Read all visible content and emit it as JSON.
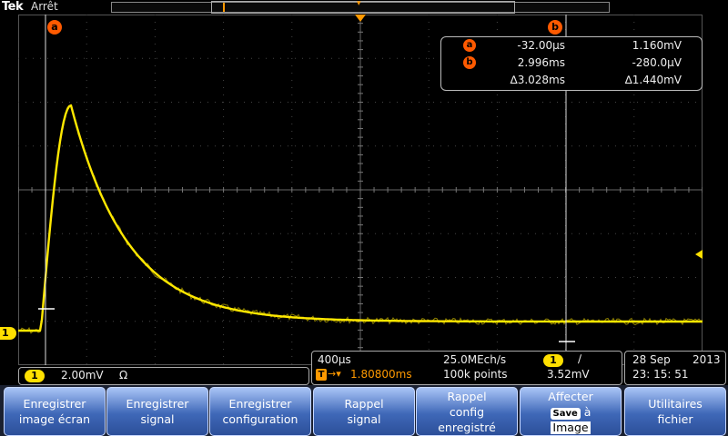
{
  "brand": "Tek",
  "run_state": "Arrêt",
  "trace_color": "#ffe800",
  "cursor_color": "#ff5a00",
  "cursors": {
    "a_label": "a",
    "b_label": "b",
    "a_time": "-32.00µs",
    "a_volt": "1.160mV",
    "b_time": "2.996ms",
    "b_volt": "-280.0µV",
    "delta_time": "∆3.028ms",
    "delta_volt": "∆1.440mV"
  },
  "channel": {
    "marker": "1",
    "scale": "2.00mV",
    "coupling": "Ω"
  },
  "acquisition": {
    "timebase": "400µs",
    "trigger_icon": "T",
    "trigger_pos": "1.80800ms",
    "sample_rate": "25.0MEch/s",
    "record_length": "100k points",
    "trigger_source": "1",
    "trigger_slope": "∕",
    "trigger_level": "3.52mV"
  },
  "datetime": {
    "date": "28 Sep",
    "year": "2013",
    "time": "23: 15: 51"
  },
  "softkeys": {
    "k1_l1": "Enregistrer",
    "k1_l2": "image écran",
    "k2_l1": "Enregistrer",
    "k2_l2": "signal",
    "k3_l1": "Enregistrer",
    "k3_l2": "configuration",
    "k4_l1": "Rappel",
    "k4_l2": "signal",
    "k5_l1": "Rappel",
    "k5_l2": "config",
    "k5_l3": "enregistré",
    "k6_l1": "Affecter",
    "k6_save": "Save",
    "k6_a": "à",
    "k6_l3": "Image",
    "k7_l1": "Utilitaires",
    "k7_l2": "fichier"
  }
}
